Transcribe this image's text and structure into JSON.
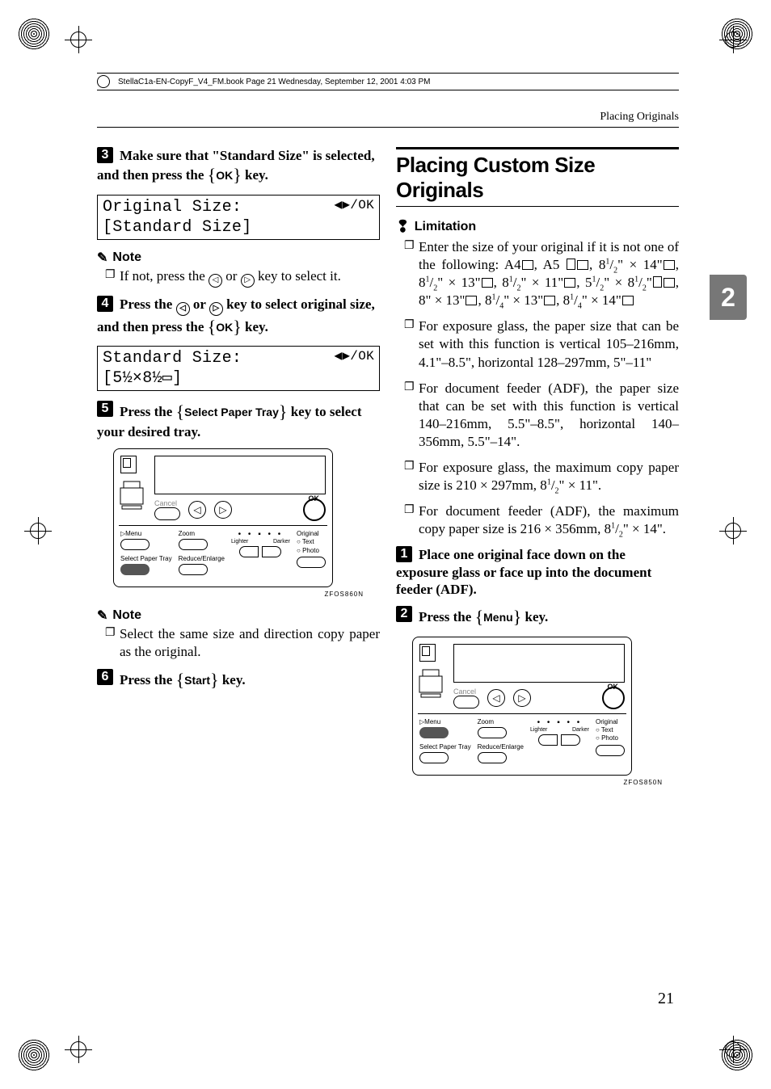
{
  "print_header": "StellaC1a-EN-CopyF_V4_FM.book  Page 21  Wednesday, September 12, 2001  4:03 PM",
  "running_head": "Placing Originals",
  "tab": "2",
  "folio": "21",
  "left": {
    "step3": "Make sure that \"Standard Size\" is selected, and then press the ",
    "step3_key": "OK",
    "step3_tail": " key.",
    "lcd1_line1a": "Original Size:",
    "lcd1_line1b": "◀▶/OK",
    "lcd1_line2": "[Standard Size]",
    "note1_head": "Note",
    "note1_item": "If not, press the ",
    "note1_item_mid": " or ",
    "note1_item_tail": " key to select it.",
    "step4a": "Press the ",
    "step4b": " or ",
    "step4c": " key to select original size, and then press the ",
    "step4_key": "OK",
    "step4_tail": " key.",
    "lcd2_line1a": "Standard Size:",
    "lcd2_line1b": "◀▶/OK",
    "lcd2_line2": "[5½×8½▭]",
    "step5a": "Press the ",
    "step5_key": "Select Paper Tray",
    "step5b": " key to select your desired tray.",
    "note2_head": "Note",
    "note2_item": "Select the same size and direction copy paper as the original.",
    "step6a": "Press the ",
    "step6_key": "Start",
    "step6b": " key."
  },
  "right": {
    "section_title": "Placing Custom Size Originals",
    "limitation_head": "Limitation",
    "lim1a": "Enter the size of your original if it is not one of the following: A4",
    "lim1b": ", A5",
    "lim1c": ", 8",
    "lim1d": "\" × 14\"",
    "lim1e": ", 8",
    "lim1f": "\" × 13\"",
    "lim1g": ", 8",
    "lim1h": "\" × 11\"",
    "lim1i": ", 5",
    "lim1j": "\" × 8",
    "lim1k": "\"",
    "lim1l": ", 8\" × 13\"",
    "lim1m": ", 8",
    "lim1n": "\" × 13\"",
    "lim1o": ", 8",
    "lim1p": "\" × 14\"",
    "lim2": "For exposure glass, the paper size that can be set with this function is vertical 105–216mm, 4.1\"–8.5\", horizontal 128–297mm, 5\"–11\"",
    "lim3": "For document feeder (ADF), the paper size that can be set with this function is vertical 140–216mm, 5.5\"–8.5\", horizontal 140–356mm, 5.5\"–14\".",
    "lim4a": "For exposure glass, the maximum copy paper size is 210 × 297mm, 8",
    "lim4b": "\" × 11\".",
    "lim5a": "For document feeder (ADF), the maximum copy paper size is 216 × 356mm, 8",
    "lim5b": "\" × 14\".",
    "step1": "Place one original face down on the exposure glass or face up into the document feeder (ADF).",
    "step2a": "Press the ",
    "step2_key": "Menu",
    "step2b": " key."
  },
  "panel": {
    "cancel": "Cancel",
    "ok": "OK",
    "menu": "Menu",
    "zoom": "Zoom",
    "spt": "Select Paper Tray",
    "re": "Reduce/Enlarge",
    "lighter": "Lighter",
    "darker": "Darker",
    "original": "Original",
    "text": "Text",
    "photo": "Photo",
    "id": "ZFOS860N",
    "id2": "ZFOS850N"
  }
}
